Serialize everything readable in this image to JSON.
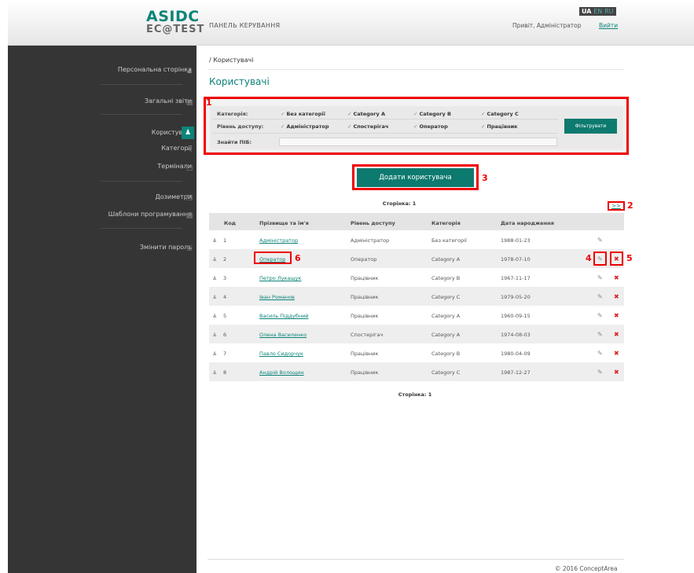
{
  "header": {
    "logo_top": "ASIDC",
    "logo_bottom": "EC@TEST",
    "panel_title": "ПАНЕЛЬ КЕРУВАННЯ",
    "lang_active": "UA",
    "lang_en": "EN",
    "lang_ru": "RU",
    "greeting": "Привіт, Адміністратор",
    "logout": "Вийти"
  },
  "sidebar": {
    "items": [
      {
        "label": "Персональна сторінка",
        "icon": "user-icon"
      },
      {
        "label": "Загальні звіти",
        "icon": "report-icon"
      },
      {
        "label": "Користувачі",
        "icon": "users-icon",
        "active": true
      },
      {
        "label": "Категорії",
        "icon": "share-icon"
      },
      {
        "label": "Термінали",
        "icon": "monitor-icon"
      },
      {
        "label": "Дозиметри",
        "icon": "device-icon"
      },
      {
        "label": "Шаблони програмування",
        "icon": "template-icon"
      },
      {
        "label": "Змінити пароль",
        "icon": "lock-icon"
      }
    ]
  },
  "breadcrumb": "/ Користувачі",
  "page_title": "Користувачі",
  "filters": {
    "category_label": "Категорія:",
    "categories": [
      "Без категорії",
      "Category A",
      "Category B",
      "Category C"
    ],
    "access_label": "Рівень доступу:",
    "access_levels": [
      "Адміністратор",
      "Спостерігач",
      "Оператор",
      "Працівник"
    ],
    "search_label": "Знайти ПІБ:",
    "search_value": "",
    "filter_button": "Фільтрувати"
  },
  "add_button": "Додати користувача",
  "page_top": "Сторінка: 1",
  "page_bottom": "Сторінка: 1",
  "next_label": ">>",
  "markers": [
    "1",
    "2",
    "3",
    "4",
    "5",
    "6"
  ],
  "table": {
    "headers": [
      "Код",
      "Прізвище та ім'я",
      "Рівень доступу",
      "Категорія",
      "Дата народження"
    ],
    "rows": [
      {
        "id": "1",
        "name": "Адміністратор",
        "access": "Адміністратор",
        "category": "Без категорії",
        "dob": "1988-01-23"
      },
      {
        "id": "2",
        "name": "Оператор",
        "access": "Оператор",
        "category": "Category A",
        "dob": "1978-07-10"
      },
      {
        "id": "3",
        "name": "Петро Лукащук",
        "access": "Працівник",
        "category": "Category B",
        "dob": "1967-11-17"
      },
      {
        "id": "4",
        "name": "Іван Романов",
        "access": "Працівник",
        "category": "Category C",
        "dob": "1979-05-20"
      },
      {
        "id": "5",
        "name": "Василь Піддубний",
        "access": "Працівник",
        "category": "Category A",
        "dob": "1960-09-15"
      },
      {
        "id": "6",
        "name": "Олена Василенко",
        "access": "Спостерігач",
        "category": "Category A",
        "dob": "1974-08-03"
      },
      {
        "id": "7",
        "name": "Павло Сидорчук",
        "access": "Працівник",
        "category": "Category B",
        "dob": "1980-04-09"
      },
      {
        "id": "8",
        "name": "Андрій Волощин",
        "access": "Працівник",
        "category": "Category C",
        "dob": "1987-12-27"
      }
    ]
  },
  "footer": "© 2016 ConceptArea"
}
